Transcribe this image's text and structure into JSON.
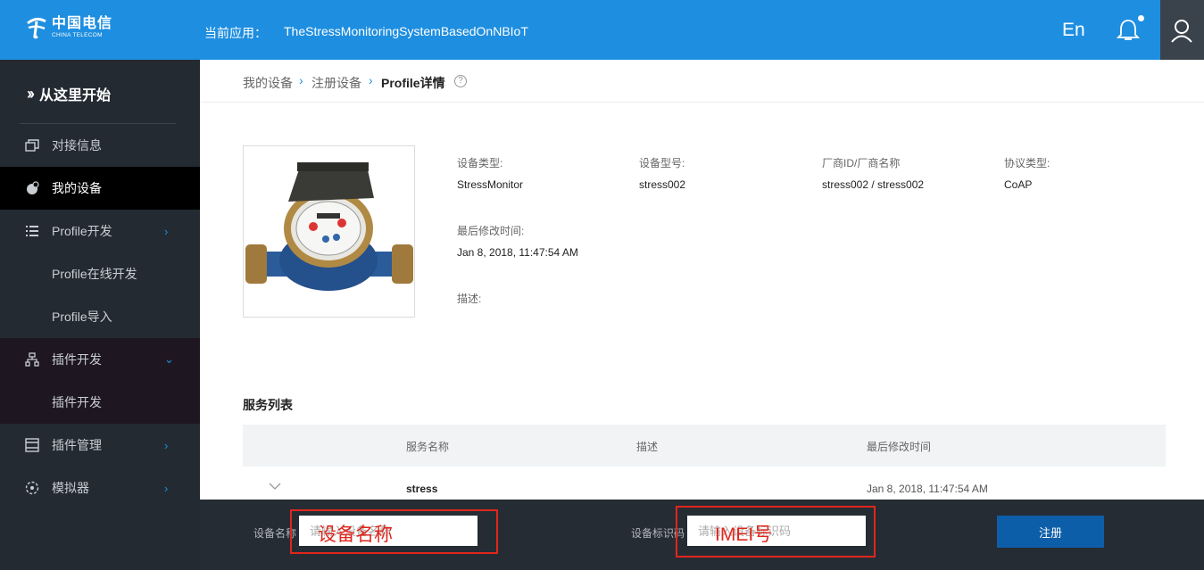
{
  "header": {
    "logo_cn": "中国电信",
    "logo_en": "CHINA TELECOM",
    "app_label": "当前应用：",
    "app_name": "TheStressMonitoringSystemBasedOnNBIoT",
    "lang_toggle": "En",
    "notification_badge": true,
    "accent_color": "#1e8ee0"
  },
  "sidebar": {
    "start_here": "从这里开始",
    "items": [
      {
        "label": "对接信息",
        "icon": "window-icon"
      },
      {
        "label": "我的设备",
        "icon": "device-icon",
        "active": true
      },
      {
        "label": "Profile开发",
        "icon": "list-icon",
        "arrow": "›"
      },
      {
        "label": "Profile在线开发"
      },
      {
        "label": "Profile导入"
      },
      {
        "label": "插件开发",
        "icon": "hierarchy-icon",
        "arrow": "⌄"
      },
      {
        "label": "插件开发"
      },
      {
        "label": "插件管理",
        "icon": "panel-icon",
        "arrow": "›"
      },
      {
        "label": "模拟器",
        "icon": "simulator-icon",
        "arrow": "›"
      }
    ]
  },
  "breadcrumb": {
    "items": [
      "我的设备",
      "注册设备"
    ],
    "current": "Profile详情",
    "help": "?"
  },
  "profile": {
    "fields": [
      {
        "label": "设备类型:",
        "value": "StressMonitor"
      },
      {
        "label": "设备型号:",
        "value": "stress002"
      },
      {
        "label": "厂商ID/厂商名称",
        "value": "stress002 / stress002"
      },
      {
        "label": "协议类型:",
        "value": "CoAP"
      },
      {
        "label": "最后修改时间:",
        "value": "Jan 8, 2018, 11:47:54 AM"
      },
      {
        "label": "描述:",
        "value": ""
      }
    ]
  },
  "services": {
    "title": "服务列表",
    "columns": [
      "服务名称",
      "描述",
      "最后修改时间"
    ],
    "rows": [
      {
        "name": "stress",
        "desc": "",
        "modified": "Jan 8, 2018, 11:47:54 AM"
      }
    ]
  },
  "register": {
    "name_label": "设备名称",
    "name_placeholder": "请输入设备名称",
    "name_annotation": "设备名称",
    "id_label": "设备标识码",
    "id_placeholder": "请输入设备标识码",
    "id_annotation": "IMEI号",
    "button": "注册"
  }
}
